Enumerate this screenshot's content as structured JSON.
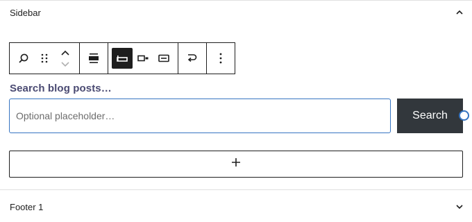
{
  "sidebar_panel": {
    "title": "Sidebar",
    "toggle_icon": "chevron-up-icon"
  },
  "toolbar": {
    "groups": [
      [
        "search-block-icon",
        "drag-handle-icon",
        "move-up-down-icon"
      ],
      [
        "align-icon"
      ],
      [
        "button-outside-icon",
        "button-inside-icon",
        "button-only-icon"
      ],
      [
        "transform-icon"
      ],
      [
        "more-options-icon"
      ]
    ],
    "active": "button-outside-icon"
  },
  "search": {
    "label": "Search blog posts…",
    "placeholder": "Optional placeholder…",
    "input_value": "",
    "button_label": "Search",
    "accent_color": "#3574c2",
    "button_color": "#32373c"
  },
  "add_block": {
    "icon": "plus-icon"
  },
  "footer_panel": {
    "title": "Footer 1",
    "toggle_icon": "chevron-down-icon"
  }
}
